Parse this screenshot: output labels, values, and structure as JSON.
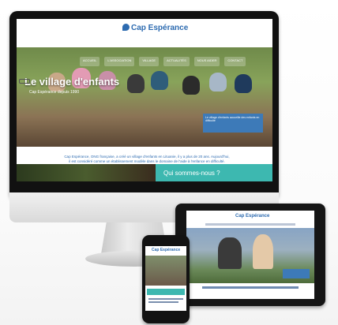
{
  "site": {
    "logo": "Cap Espérance",
    "nav": [
      "ACCUEIL",
      "L'ASSOCIATION",
      "VILLAGE",
      "ACTUALITÉS",
      "NOUS AIDER",
      "CONTACT"
    ],
    "hero_title": "Le village d'enfants",
    "hero_subtitle": "Cap Espérance depuis 1990",
    "hero_badge": "Le village d'enfants accueille des enfants en difficulté",
    "intro": "Cap Espérance, ONG française, a créé un village d'enfants en Lituanie, il y a plus de 20 ans. Aujourd'hui, il est considéré comme un établissement modèle dans le domaine de l'aide à l'enfance en difficulté.",
    "cta_teal": "Qui sommes-nous ?"
  },
  "tablet": {
    "logo": "Cap Espérance"
  },
  "phone": {
    "logo": "Cap Espérance"
  },
  "colors": {
    "brand_blue": "#2d6bb0",
    "teal": "#3db8b0"
  }
}
